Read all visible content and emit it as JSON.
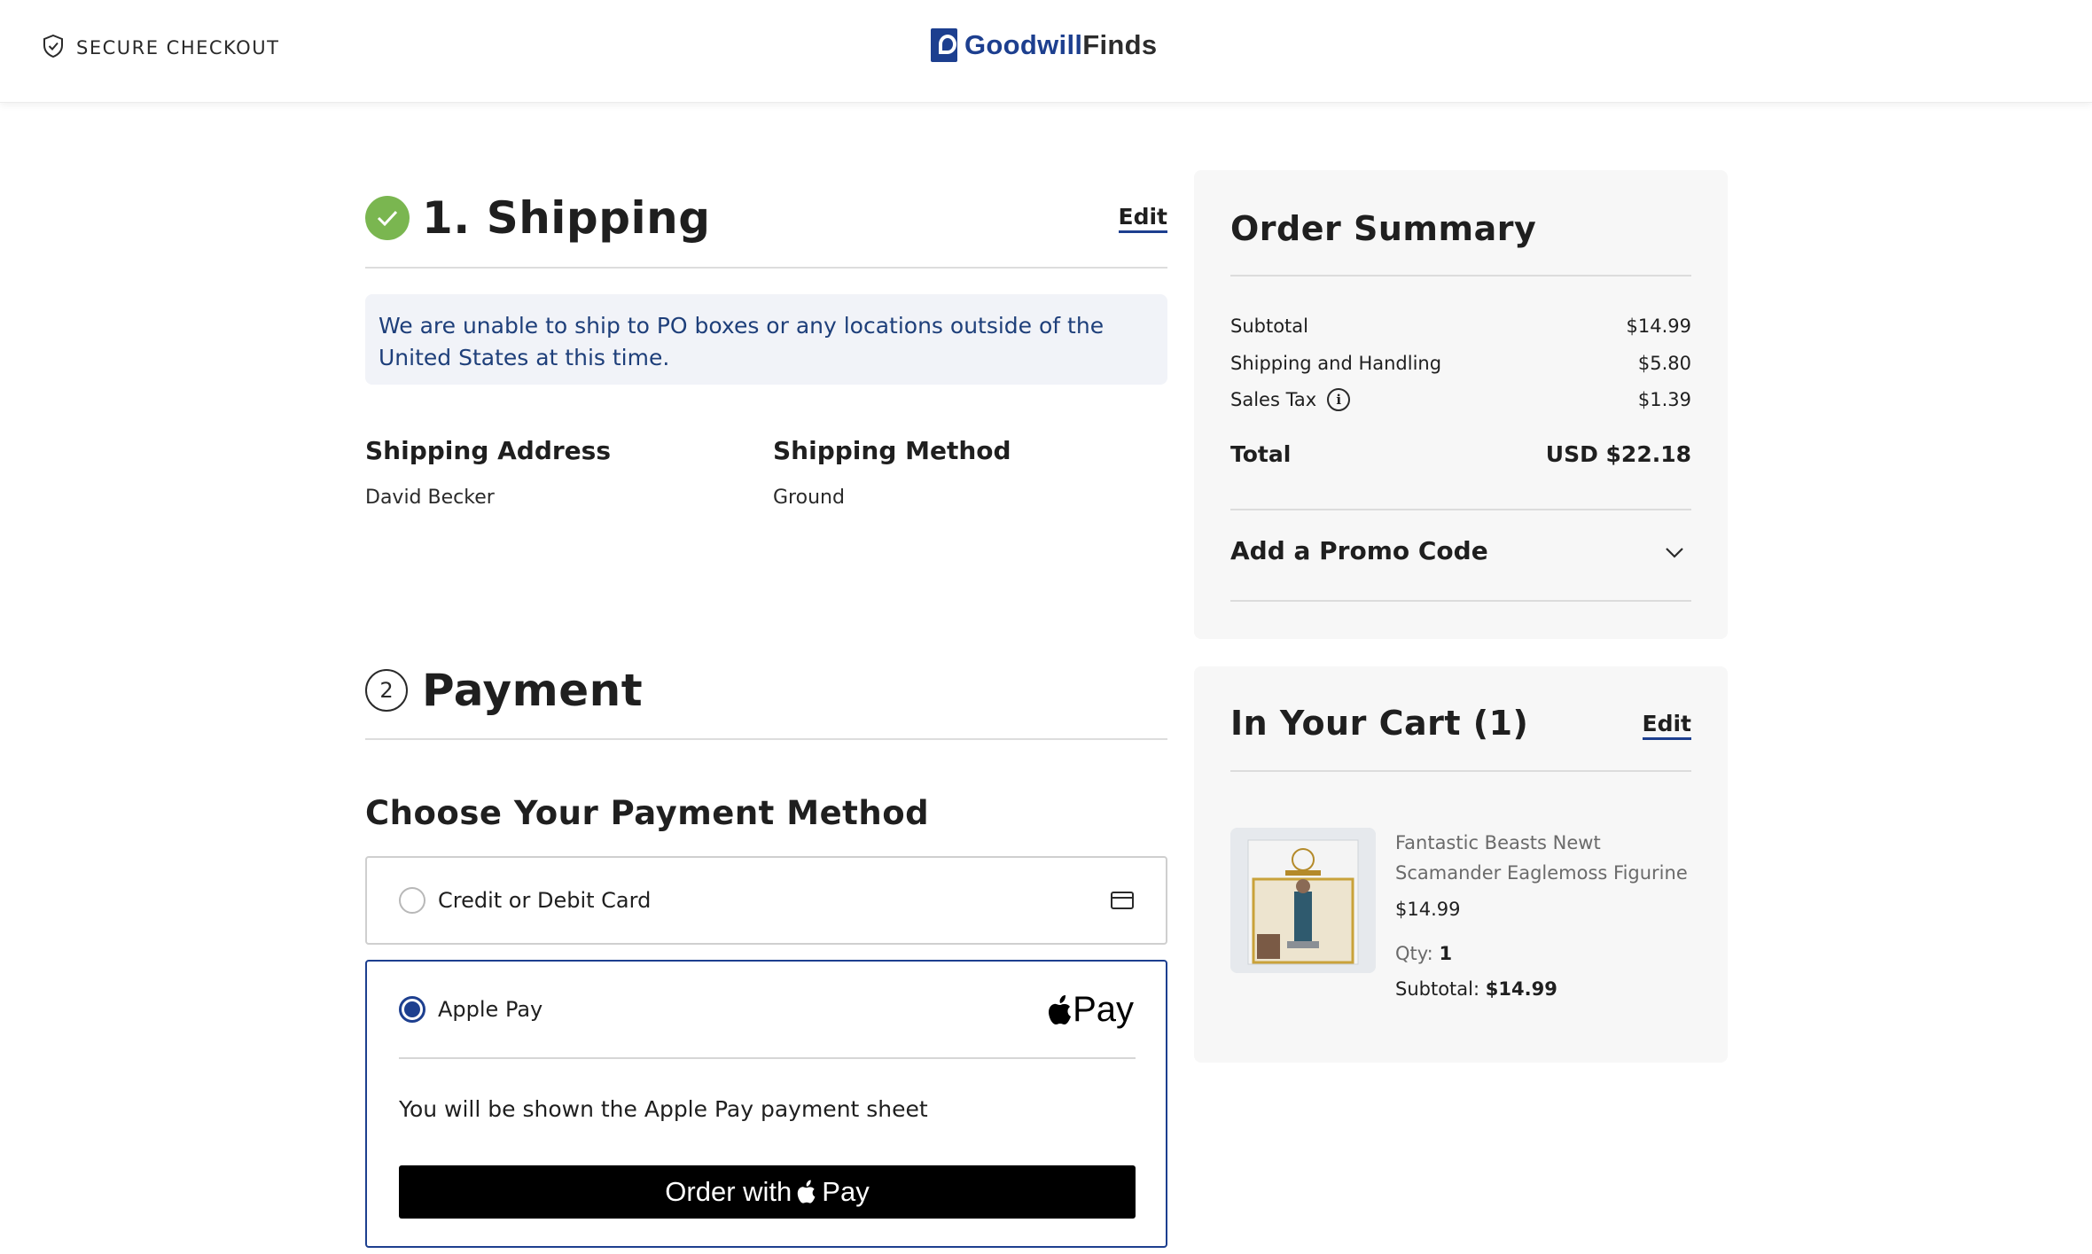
{
  "header": {
    "secure_label": "SECURE CHECKOUT",
    "logo_part1": "Goodwill",
    "logo_part2": "Finds"
  },
  "shipping": {
    "title": "1. Shipping",
    "edit_label": "Edit",
    "notice": "We are unable to ship to PO boxes or any locations outside of the United States at this time.",
    "address_heading": "Shipping Address",
    "address_value": "David Becker",
    "method_heading": "Shipping Method",
    "method_value": "Ground"
  },
  "payment": {
    "step_number": "2",
    "title": "Payment",
    "choose_heading": "Choose Your Payment Method",
    "options": [
      {
        "label": "Credit or Debit Card",
        "selected": false,
        "icon": "credit-card-icon"
      },
      {
        "label": "Apple Pay",
        "selected": true,
        "icon": "apple-pay-icon"
      }
    ],
    "apple_pay_mark": "Pay",
    "apple_pay_note": "You will be shown the Apple Pay payment sheet",
    "order_button_prefix": "Order with",
    "order_button_suffix": "Pay"
  },
  "order_summary": {
    "title": "Order Summary",
    "rows": [
      {
        "label": "Subtotal",
        "value": "$14.99"
      },
      {
        "label": "Shipping and Handling",
        "value": "$5.80"
      },
      {
        "label": "Sales Tax",
        "value": "$1.39"
      }
    ],
    "total_label": "Total",
    "total_value": "USD $22.18",
    "promo_label": "Add a Promo Code"
  },
  "cart": {
    "title": "In Your Cart (1)",
    "edit_label": "Edit",
    "item": {
      "name": "Fantastic Beasts Newt Scamander Eaglemoss Figurine",
      "price": "$14.99",
      "qty_label": "Qty:",
      "qty_value": "1",
      "subtotal_label": "Subtotal:",
      "subtotal_value": "$14.99"
    }
  },
  "colors": {
    "brand_blue": "#1d3f8f",
    "success_green": "#7ab650",
    "notice_text": "#1e3f7a"
  }
}
